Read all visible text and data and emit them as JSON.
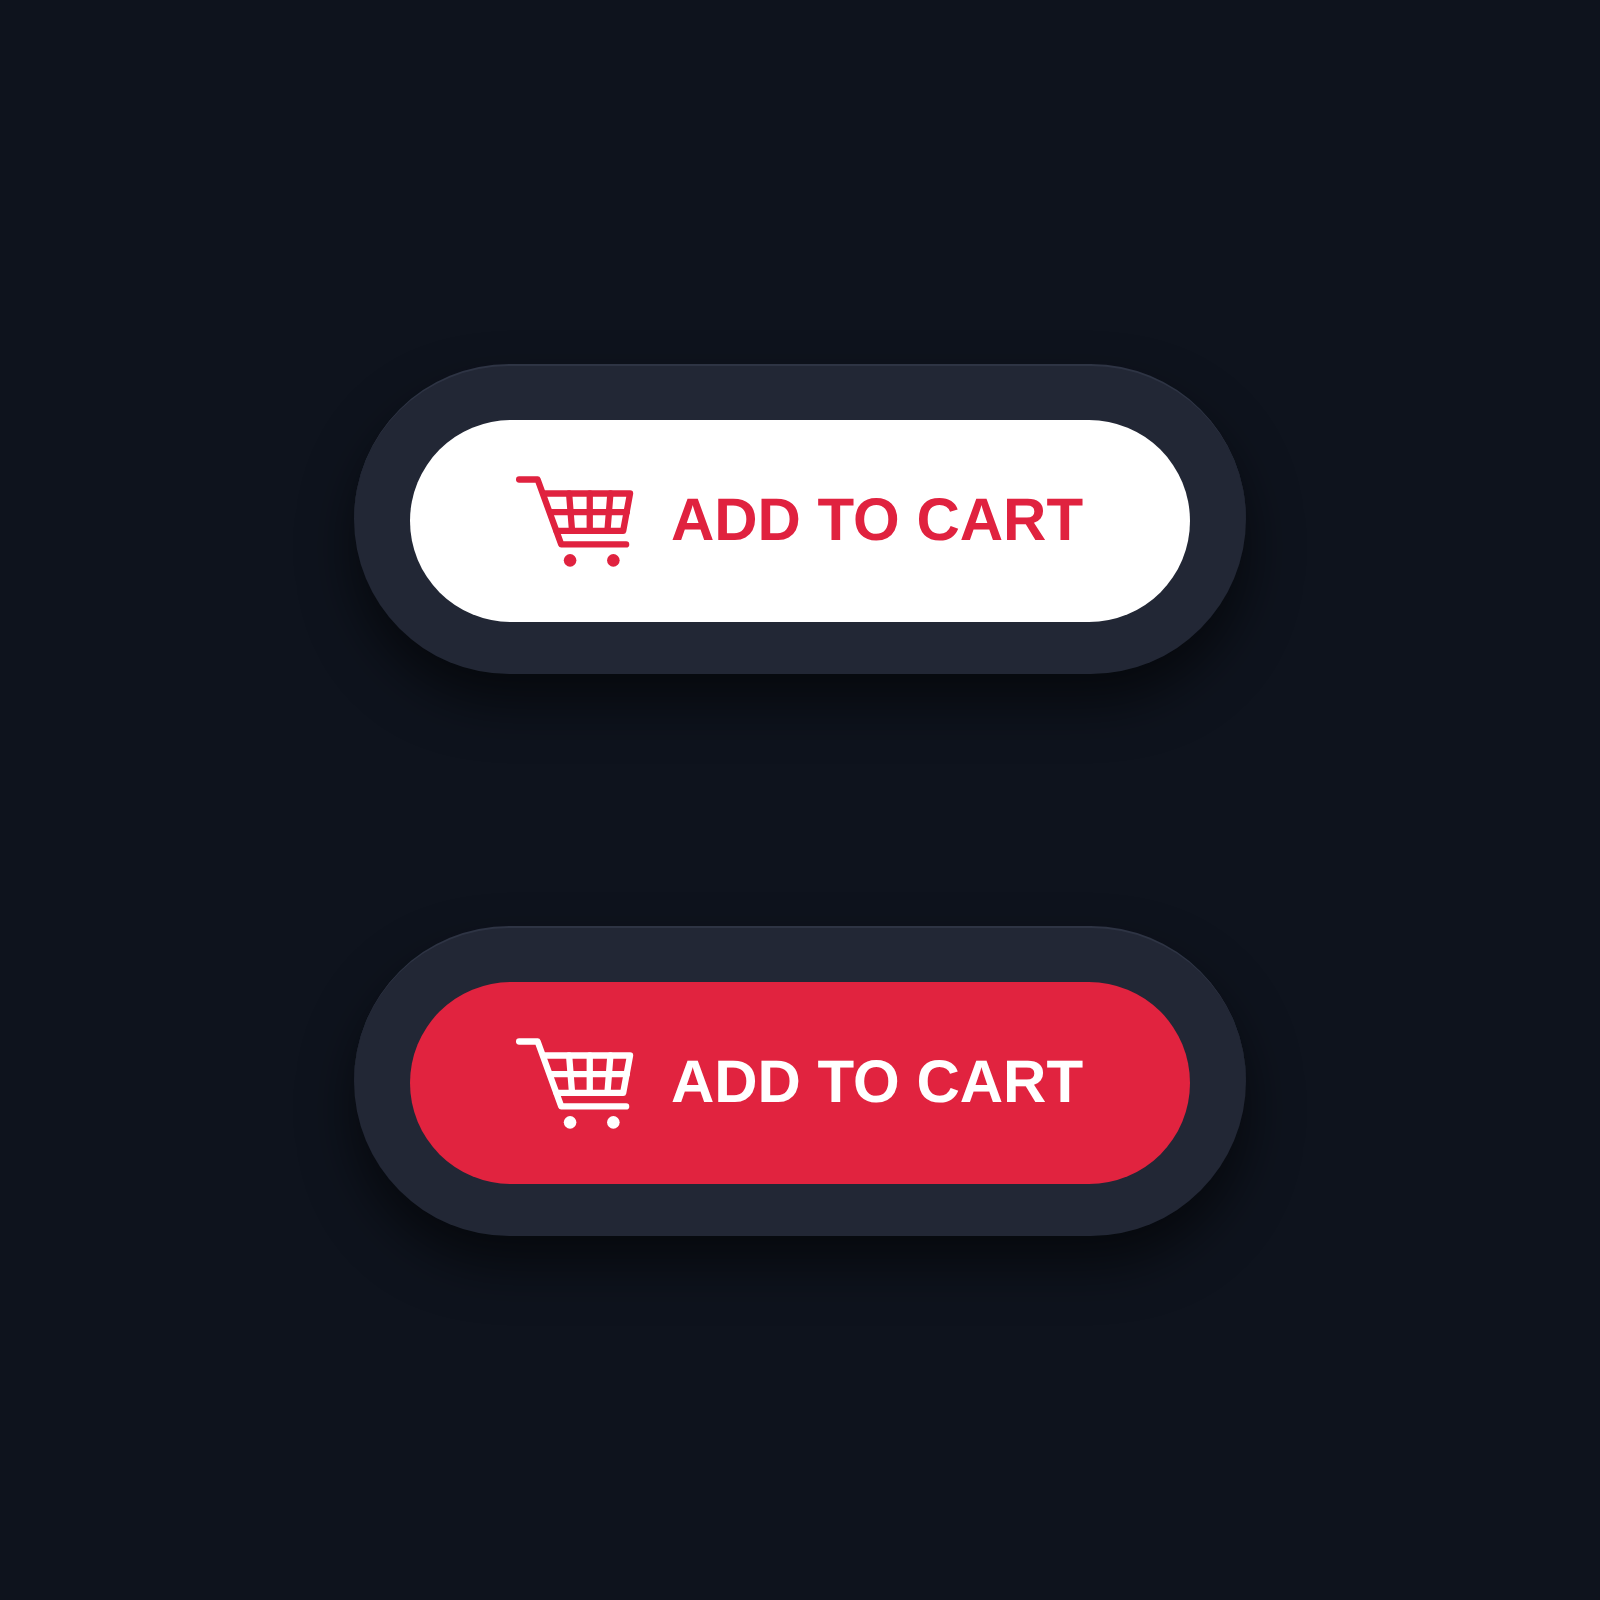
{
  "buttons": [
    {
      "kind": "light",
      "label": "ADD TO CART"
    },
    {
      "kind": "solid",
      "label": "ADD TO CART"
    }
  ]
}
